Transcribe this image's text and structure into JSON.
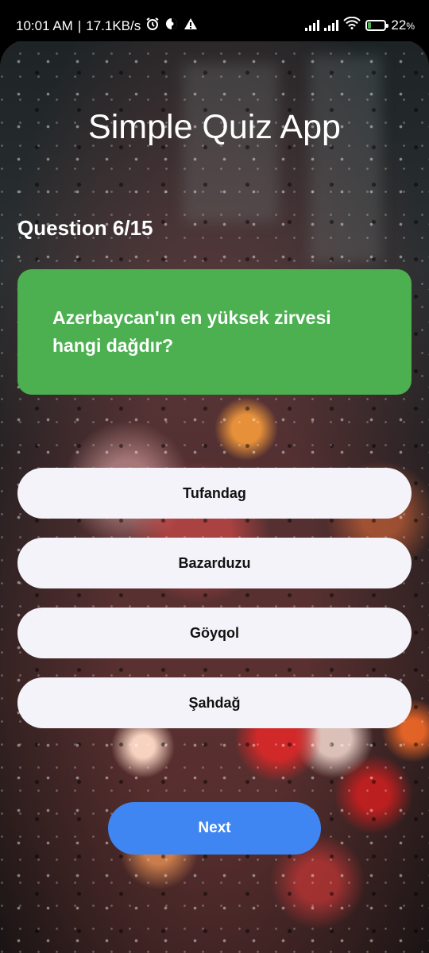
{
  "status_bar": {
    "time": "10:01 AM",
    "speed": "17.1KB/s",
    "battery": "22",
    "battery_unit": "%",
    "battery_level": 0.22,
    "icons": [
      "alarm-icon",
      "vpn-icon",
      "warning-icon",
      "signal-icon",
      "signal-icon",
      "wifi-icon",
      "battery-charging-icon"
    ]
  },
  "app": {
    "title": "Simple Quiz App",
    "question_counter": "Question 6/15",
    "question_text": "Azerbaycan'ın en yüksek zirvesi hangi dağdır?",
    "answers": [
      {
        "label": "Tufandag"
      },
      {
        "label": "Bazarduzu"
      },
      {
        "label": "Göyqol"
      },
      {
        "label": "Şahdağ"
      }
    ],
    "next_label": "Next"
  },
  "colors": {
    "question_card": "#4caf50",
    "answer_bg": "#f4f3f9",
    "next_button": "#3f86f2"
  }
}
